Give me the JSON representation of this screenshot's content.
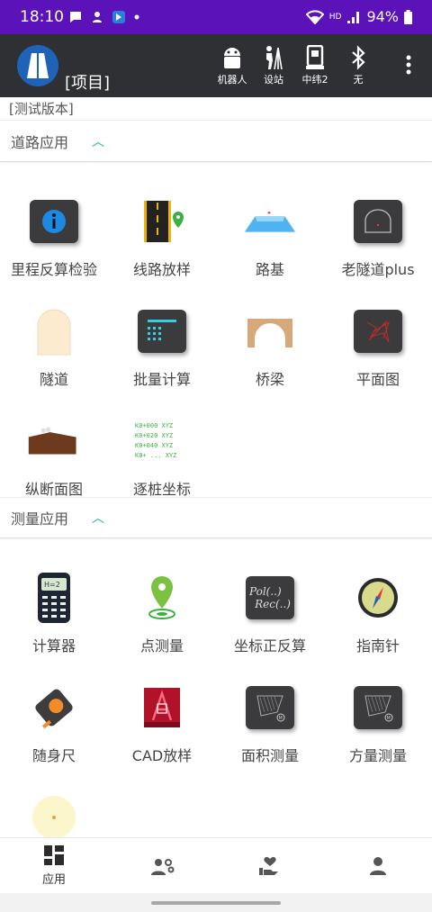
{
  "status_bar": {
    "time": "18:10",
    "battery": "94%",
    "hd": "HD"
  },
  "app_bar": {
    "project": "[项目]",
    "actions": [
      {
        "label": "机器人",
        "icon": "android-icon"
      },
      {
        "label": "设站",
        "icon": "surveyor-icon"
      },
      {
        "label": "中纬2",
        "icon": "total-station-icon"
      },
      {
        "label": "无",
        "icon": "bluetooth-icon"
      }
    ]
  },
  "version_label": "[测试版本]",
  "sections": [
    {
      "title": "道路应用",
      "items": [
        {
          "label": "里程反算检验",
          "icon": "info-icon"
        },
        {
          "label": "线路放样",
          "icon": "road-pin-icon"
        },
        {
          "label": "路基",
          "icon": "subgrade-icon"
        },
        {
          "label": "老隧道plus",
          "icon": "old-tunnel-icon"
        },
        {
          "label": "隧道",
          "icon": "tunnel-icon"
        },
        {
          "label": "批量计算",
          "icon": "batch-calc-icon"
        },
        {
          "label": "桥梁",
          "icon": "bridge-icon"
        },
        {
          "label": "平面图",
          "icon": "plan-view-icon"
        },
        {
          "label": "纵断面图",
          "icon": "profile-icon"
        },
        {
          "label": "逐桩坐标",
          "icon": "pile-coords-icon"
        }
      ]
    },
    {
      "title": "测量应用",
      "items": [
        {
          "label": "计算器",
          "icon": "calculator-icon"
        },
        {
          "label": "点测量",
          "icon": "point-survey-icon"
        },
        {
          "label": "坐标正反算",
          "icon": "coord-convert-icon"
        },
        {
          "label": "指南针",
          "icon": "compass-icon"
        },
        {
          "label": "随身尺",
          "icon": "tape-measure-icon"
        },
        {
          "label": "CAD放样",
          "icon": "cad-stakeout-icon"
        },
        {
          "label": "面积测量",
          "icon": "area-measure-icon"
        },
        {
          "label": "方量测量",
          "icon": "volume-measure-icon"
        }
      ]
    }
  ],
  "pile_text": [
    "K0+000 XYZ",
    "K0+020 XYZ",
    "K0+040 XYZ",
    "K0+ ... XYZ"
  ],
  "coord_text": [
    "Pol(..)",
    "Rec(..)"
  ],
  "calc_screen": "H=2",
  "bottom_nav": [
    {
      "label": "应用",
      "icon": "apps-icon"
    },
    {
      "label": "",
      "icon": "team-settings-icon"
    },
    {
      "label": "",
      "icon": "care-icon"
    },
    {
      "label": "",
      "icon": "person-icon"
    }
  ],
  "colors": {
    "status_bar": "#5b12b8",
    "app_bar": "#2e3033",
    "accent": "#19b59a"
  }
}
